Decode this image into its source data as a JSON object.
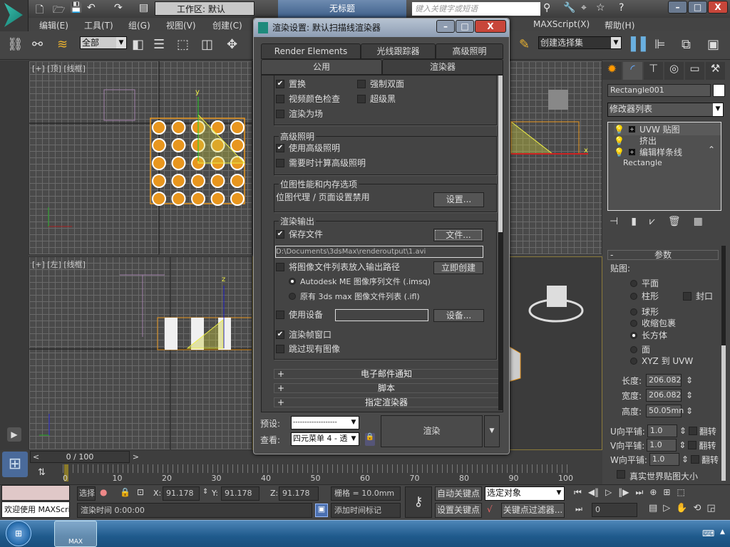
{
  "app": {
    "title": "无标题",
    "workspace": "工作区: 默认",
    "search_placeholder": "键入关键字或短语",
    "window_buttons": {
      "minimize": "–",
      "maximize": "□",
      "close": "X"
    }
  },
  "menu": [
    "编辑(E)",
    "工具(T)",
    "组(G)",
    "视图(V)",
    "创建(C)",
    "MAXScript(X)",
    "帮助(H)"
  ],
  "toolbar": {
    "selection_filter": "全部",
    "named_selection": "创建选择集"
  },
  "viewports": {
    "top_left": "[+] [顶] [线框]",
    "bottom_left": "[+] [左] [线框]",
    "axis_labels": {
      "x": "x",
      "y": "y",
      "z": "z"
    }
  },
  "timeline": {
    "frame": "0 / 100",
    "ticks": [
      "0",
      "10",
      "20",
      "30",
      "40",
      "50",
      "60",
      "70",
      "80",
      "90",
      "100"
    ],
    "position": 0
  },
  "command_panel": {
    "object_name": "Rectangle001",
    "modifier_list": "修改器列表",
    "stack": [
      "UVW 贴图",
      "挤出",
      "编辑样条线",
      "Rectangle"
    ],
    "rollout": "参数",
    "mapping_label": "贴图:",
    "mapping_options": [
      "平面",
      "柱形",
      "球形",
      "收缩包裹",
      "长方体",
      "面",
      "XYZ 到 UVW"
    ],
    "mapping_selected": "长方体",
    "cap_label": "封口",
    "length_label": "长度:",
    "length": "206.082",
    "width_label": "宽度:",
    "width": "206.082",
    "height_label": "高度:",
    "height": "50.05mn",
    "u_tile_label": "U向平铺:",
    "u_tile": "1.0",
    "v_tile_label": "V向平铺:",
    "v_tile": "1.0",
    "w_tile_label": "W向平铺:",
    "w_tile": "1.0",
    "flip_label": "翻转",
    "real_world": "真实世界贴图大小"
  },
  "dialog": {
    "title": "渲染设置: 默认扫描线渲染器",
    "tabs_row1": [
      "Render Elements",
      "光线跟踪器",
      "高级照明"
    ],
    "tabs_row2": [
      "公用",
      "渲染器"
    ],
    "active_tab": "公用",
    "options": {
      "displacement": "置换",
      "force_2side": "强制双面",
      "video_check": "视频颜色检查",
      "super_black": "超级黑",
      "render_fields": "渲染为场"
    },
    "adv_lighting": {
      "title": "高级照明",
      "use": "使用高级照明",
      "compute": "需要时计算高级照明"
    },
    "bitmap": {
      "title": "位图性能和内存选项",
      "text": "位图代理 / 页面设置禁用",
      "setup": "设置..."
    },
    "output": {
      "title": "渲染输出",
      "save_file": "保存文件",
      "files_button": "文件...",
      "path": "D:\\Documents\\3dsMax\\renderoutput\\1.avi",
      "put_list": "将图像文件列表放入输出路径",
      "create_now": "立即创建",
      "radio_imsq": "Autodesk ME 图像序列文件 (.imsq)",
      "radio_ifl": "原有 3ds max 图像文件列表 (.ifl)",
      "use_device": "使用设备",
      "devices": "设备...",
      "vfb": "渲染帧窗口",
      "skip": "跳过现有图像"
    },
    "rollouts": [
      "电子邮件通知",
      "脚本",
      "指定渲染器"
    ],
    "preset_label": "预设:",
    "preset_value": "-------------------",
    "view_label": "查看:",
    "view_value": "四元菜单 4 - 透",
    "render_button": "渲染"
  },
  "status": {
    "maxscript": "欢迎使用 MAXScri",
    "select": "选择",
    "x_label": "X:",
    "x": "91.178",
    "y_label": "Y:",
    "y": "91.178",
    "z_label": "Z:",
    "z": "91.178",
    "grid": "栅格 = 10.0mm",
    "auto_key": "自动关键点",
    "set_key": "设置关键点",
    "key_target": "选定对象",
    "key_filters": "关键点过滤器...",
    "render_time": "渲染时间  0:00:00",
    "add_time_tag": "添加时间标记",
    "current_frame": "0"
  },
  "taskbar": {
    "app_label": "MAX"
  }
}
